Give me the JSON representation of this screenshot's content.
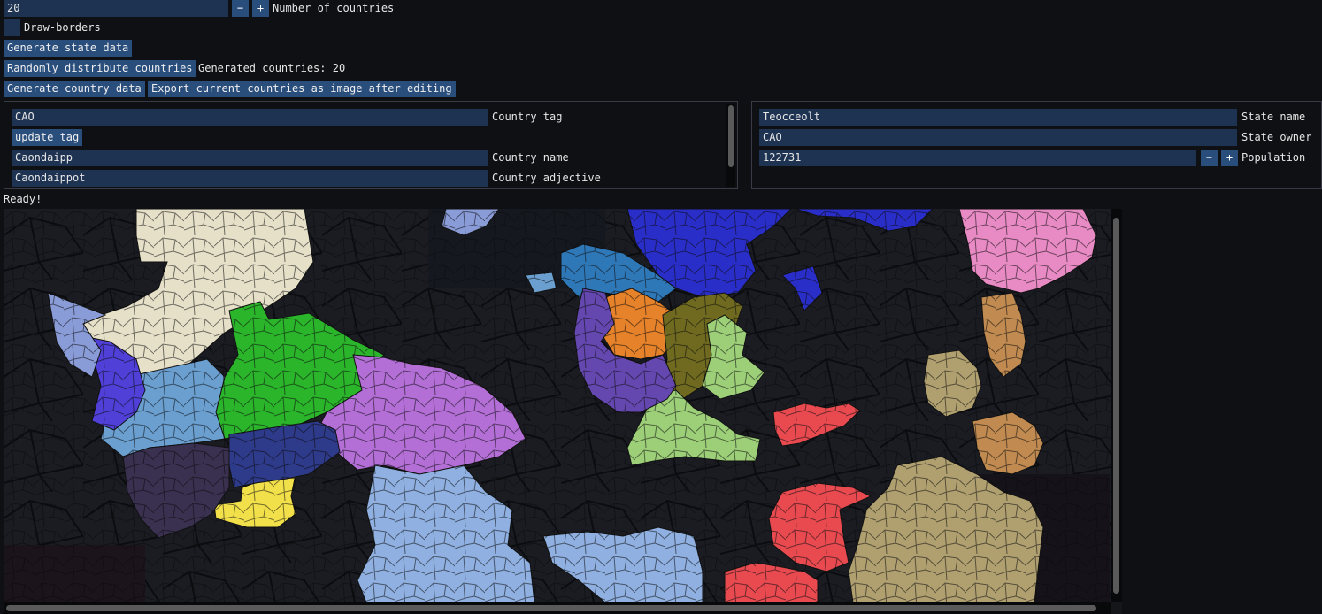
{
  "controls": {
    "country_count_value": "20",
    "minus": "−",
    "plus": "+",
    "country_count_label": "Number of countries",
    "draw_borders_label": "Draw-borders",
    "generate_state_data": "Generate state data",
    "randomly_distribute": "Randomly distribute countries",
    "generated_countries_text": "Generated countries: 20",
    "generate_country_data": "Generate country data",
    "export_image": "Export current countries as image after editing"
  },
  "country_panel": {
    "tag_value": "CAO",
    "tag_label": "Country tag",
    "update_tag": "update tag",
    "name_value": "Caondaipp",
    "name_label": "Country name",
    "adjective_value": "Caondaippot",
    "adjective_label": "Country adjective"
  },
  "state_panel": {
    "state_name_value": "Teocceolt",
    "state_name_label": "State name",
    "owner_value": "CAO",
    "owner_label": "State owner",
    "population_value": "122731",
    "population_label": "Population"
  },
  "status": "Ready!",
  "map": {
    "background": "#14161a",
    "country_colors": [
      "#e6e0c8",
      "#2bb52b",
      "#b36fd6",
      "#6a9fd0",
      "#8fb0e0",
      "#f2e04a",
      "#5040d8",
      "#2e3a8a",
      "#3a3050",
      "#8a9cd8",
      "#2f78b8",
      "#2a2ec8",
      "#e6822a",
      "#6f6a1f",
      "#9ccf78",
      "#6448b0",
      "#e84a50",
      "#e88ac4",
      "#c08a50",
      "#b0a070"
    ]
  }
}
